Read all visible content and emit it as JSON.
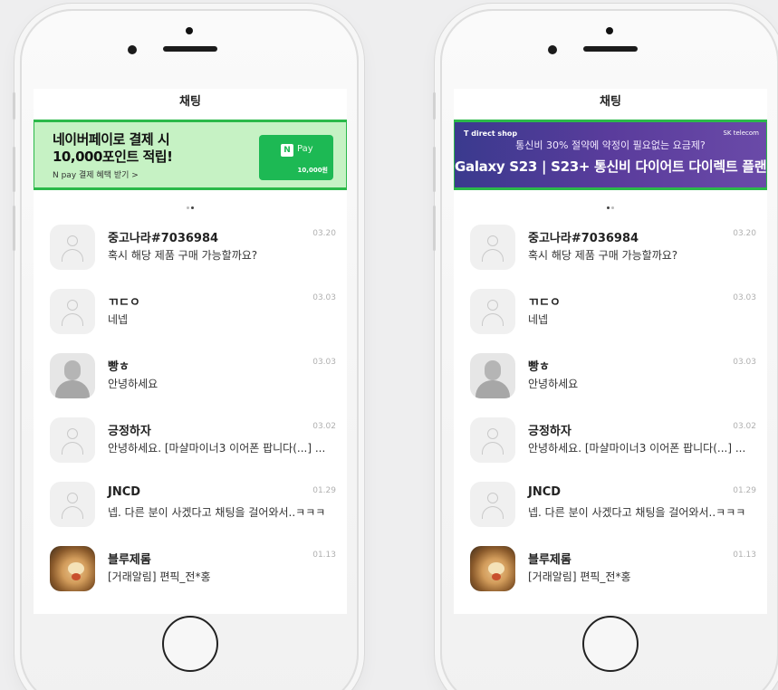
{
  "phones": [
    {
      "screen_title": "채팅",
      "banner": {
        "line1": "네이버페이로 결제 시",
        "line2": "10,000포인트 적립!",
        "sub": "N pay 결제 혜택 받기 >",
        "card_logo": "N",
        "card_label": "Pay",
        "card_amount": "10,000원"
      }
    },
    {
      "screen_title": "채팅",
      "banner": {
        "shop": "T direct shop",
        "telecom": "SK telecom",
        "sub": "통신비 30% 절약에 약정이 필요없는 요금제?",
        "main": "Galaxy S23 | S23+ 통신비 다이어트 다이렉트 플랜"
      }
    }
  ],
  "chats": [
    {
      "name": "중고나라#7036984",
      "message": "혹시 해당 제품 구매 가능할까요?",
      "date": "03.20",
      "avatar": "default"
    },
    {
      "name": "ㄲㄷㅇ",
      "message": "네넵",
      "date": "03.03",
      "avatar": "default"
    },
    {
      "name": "빵ㅎ",
      "message": "안녕하세요",
      "date": "03.03",
      "avatar": "person"
    },
    {
      "name": "긍정하자",
      "message": "안녕하세요. [마샬마이너3 이어폰 팝니다(...] ...",
      "date": "03.02",
      "avatar": "default"
    },
    {
      "name": "JNCD",
      "message": "넵. 다른 분이 사겠다고 채팅을 걸어와서..ㅋㅋㅋ",
      "date": "01.29",
      "avatar": "default"
    },
    {
      "name": "블루제롬",
      "message": "[거래알림] 편픽_전*홍",
      "date": "01.13",
      "avatar": "food"
    }
  ],
  "colors": {
    "banner_border": "#2bb94a",
    "naver_bg": "#c6f2c4",
    "naver_green": "#1db954",
    "sk_purple": "#5a3c9c"
  }
}
